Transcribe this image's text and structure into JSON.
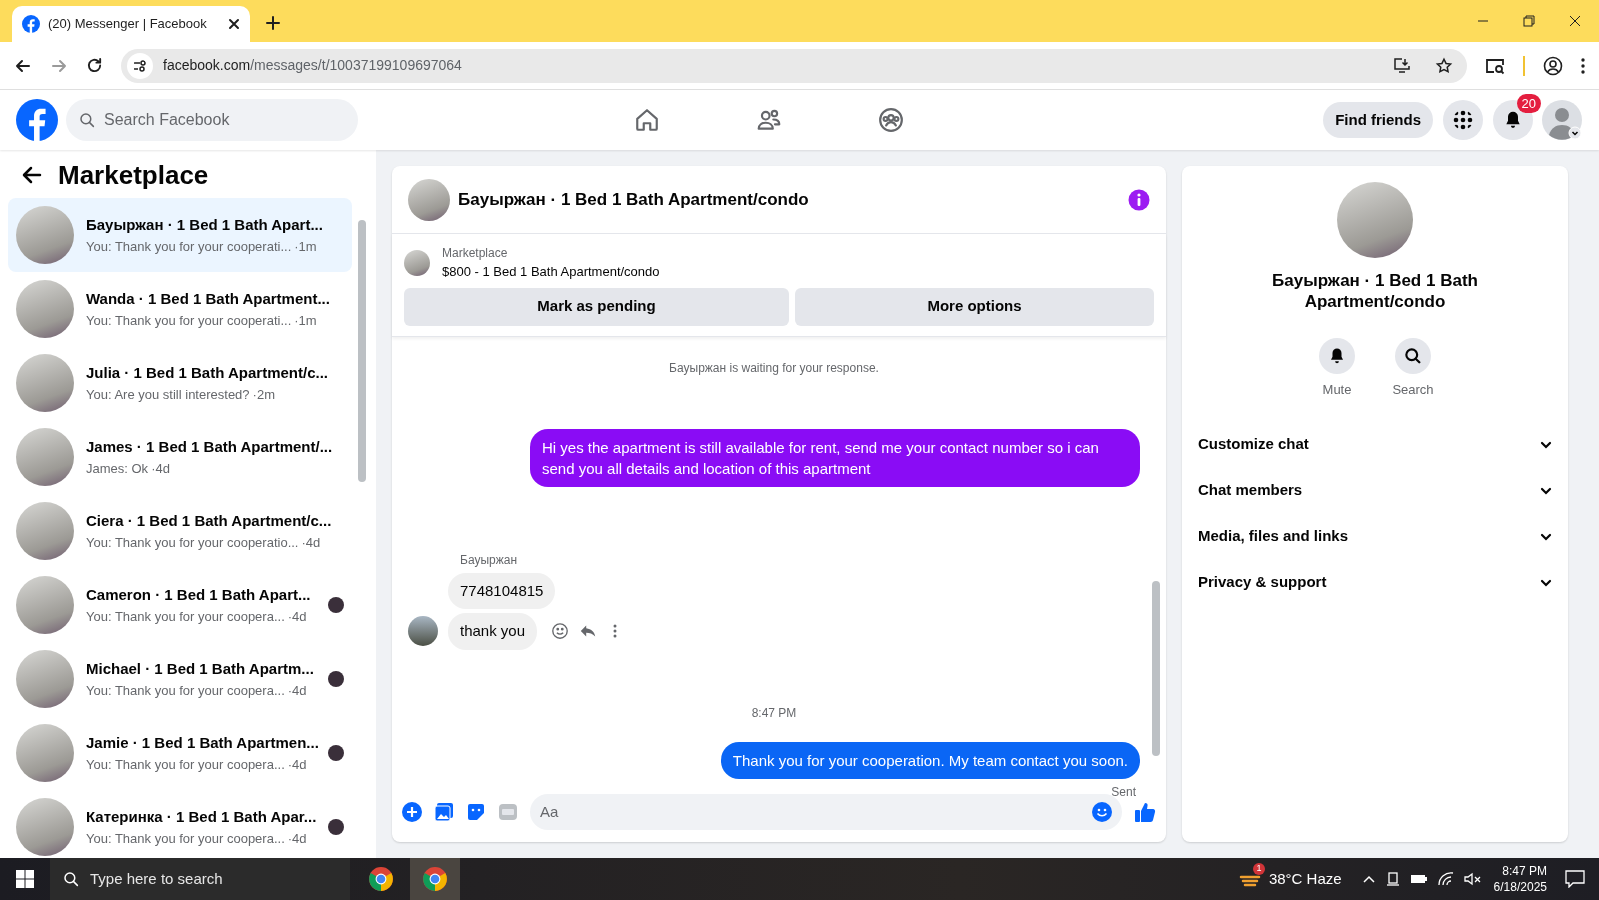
{
  "browser": {
    "tab_title": "(20) Messenger | Facebook",
    "url_domain": "facebook.com",
    "url_path": "/messages/t/10037199109697064"
  },
  "header": {
    "search_placeholder": "Search Facebook",
    "find_friends": "Find friends",
    "notification_count": "20"
  },
  "sidebar": {
    "title": "Marketplace",
    "conversations": [
      {
        "title": "Бауыржан · 1 Bed 1 Bath Apart...",
        "preview": "You: Thank you for your cooperati...",
        "time": "·1m",
        "selected": true,
        "seen": false
      },
      {
        "title": "Wanda · 1 Bed 1 Bath Apartment...",
        "preview": "You: Thank you for your cooperati...",
        "time": "·1m",
        "selected": false,
        "seen": false
      },
      {
        "title": "Julia · 1 Bed 1 Bath Apartment/c...",
        "preview": "You: Are you still interested?",
        "time": "·2m",
        "selected": false,
        "seen": false
      },
      {
        "title": "James · 1 Bed 1 Bath Apartment/...",
        "preview": "James: Ok",
        "time": "·4d",
        "selected": false,
        "seen": false
      },
      {
        "title": "Ciera · 1 Bed 1 Bath Apartment/c...",
        "preview": "You: Thank you for your cooperatio...",
        "time": "·4d",
        "selected": false,
        "seen": false
      },
      {
        "title": "Cameron · 1 Bed 1 Bath Apart...",
        "preview": "You: Thank you for your coopera...",
        "time": "·4d",
        "selected": false,
        "seen": true
      },
      {
        "title": "Michael · 1 Bed 1 Bath Apartm...",
        "preview": "You: Thank you for your coopera...",
        "time": "·4d",
        "selected": false,
        "seen": true
      },
      {
        "title": "Jamie · 1 Bed 1 Bath Apartmen...",
        "preview": "You: Thank you for your coopera...",
        "time": "·4d",
        "selected": false,
        "seen": true
      },
      {
        "title": "Катеринка · 1 Bed 1 Bath Apar...",
        "preview": "You: Thank you for your coopera...",
        "time": "·4d",
        "selected": false,
        "seen": true
      }
    ]
  },
  "chat": {
    "title": "Бауыржан · 1 Bed 1 Bath Apartment/condo",
    "listing": {
      "label": "Marketplace",
      "title": "$800 - 1 Bed 1 Bath Apartment/condo"
    },
    "actions": [
      "Mark as pending",
      "More options"
    ],
    "messages": [
      {
        "kind": "note",
        "text": "Бауыржан is waiting for your response."
      },
      {
        "kind": "sent",
        "text": "Hi yes the apartment is still available for rent, send me your contact number so i can send you all details and location of this apartment",
        "color": "#8a0cf5"
      },
      {
        "kind": "sender",
        "text": "Бауыржан"
      },
      {
        "kind": "received",
        "text": "7748104815",
        "avatar": false
      },
      {
        "kind": "received",
        "text": "thank you",
        "avatar": true
      },
      {
        "kind": "seen"
      },
      {
        "kind": "timestamp",
        "text": "8:47 PM"
      },
      {
        "kind": "sent",
        "text": "Thank you for your cooperation. My team contact you soon.",
        "color": "#0a66f5"
      },
      {
        "kind": "status",
        "text": "Sent"
      }
    ],
    "composer_placeholder": "Aa"
  },
  "info": {
    "name": "Бауыржан · 1 Bed 1 Bath Apartment/condo",
    "actions": [
      {
        "kind": "bell",
        "label": "Mute"
      },
      {
        "kind": "search",
        "label": "Search"
      }
    ],
    "sections": [
      "Customize chat",
      "Chat members",
      "Media, files and links",
      "Privacy & support"
    ]
  },
  "taskbar": {
    "search_placeholder": "Type here to search",
    "weather_badge": "1",
    "weather": "38°C Haze",
    "time": "8:47 PM",
    "date": "6/18/2025"
  }
}
